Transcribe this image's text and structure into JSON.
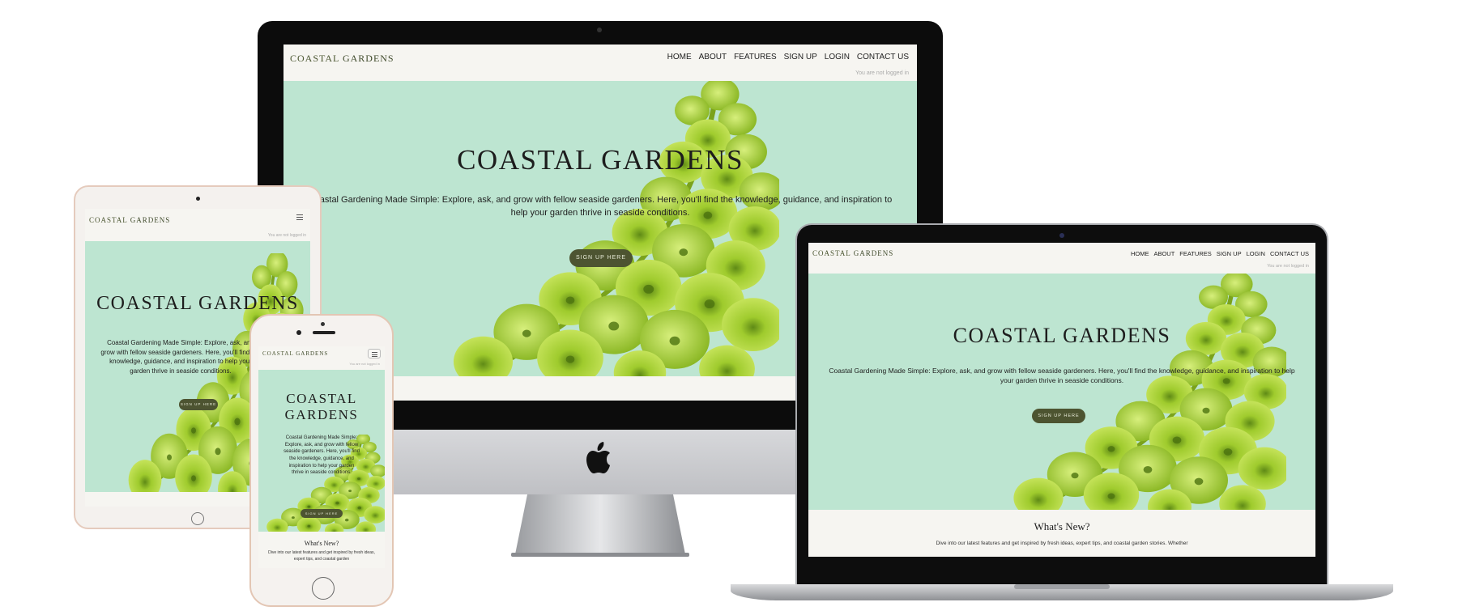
{
  "site": {
    "logo_main": "COASTAL",
    "logo_rest": "GARDENS",
    "nav": [
      "HOME",
      "ABOUT",
      "FEATURES",
      "SIGN UP",
      "LOGIN",
      "CONTACT US"
    ],
    "status": "You are not logged in",
    "hero_title": "COASTAL GARDENS",
    "hero_title_line1": "COASTAL",
    "hero_title_line2": "GARDENS",
    "hero_text_desktop": "Coastal Gardening Made Simple: Explore, ask, and grow with fellow seaside gardeners. Here, you'll find the knowledge, guidance, and inspiration to help your garden thrive in seaside conditions.",
    "hero_text_tablet": "Coastal Gardening Made Simple: Explore, ask, and grow with fellow seaside gardeners. Here, you'll find the knowledge, guidance, and inspiration to help your garden thrive in seaside conditions.",
    "hero_text_phone": "Coastal Gardening Made Simple: Explore, ask, and grow with fellow seaside gardeners. Here, you'll find the knowledge, guidance, and inspiration to help your garden thrive in seaside conditions.",
    "cta": "SIGN UP HERE",
    "whats_new_title": "What's New?",
    "whats_new_text_laptop": "Dive into our latest features and get inspired by fresh ideas, expert tips, and coastal garden stories. Whether",
    "whats_new_text_phone": "Dive into our latest features and get inspired by fresh ideas, expert tips, and coastal garden"
  },
  "colors": {
    "hero_bg": "#bde5d1",
    "header_bg": "#f6f5f1",
    "cta_bg": "#4d5431",
    "plant_green": "#8fc02a"
  },
  "icons": [
    "apple-logo-icon",
    "hamburger-menu-icon",
    "camera-icon",
    "home-button-icon"
  ]
}
